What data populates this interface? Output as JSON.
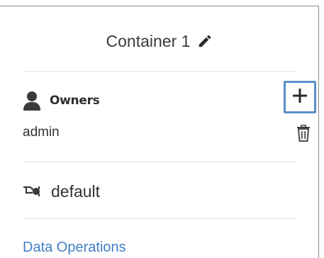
{
  "container": {
    "title": "Container 1"
  },
  "owners": {
    "label": "Owners",
    "items": [
      {
        "name": "admin"
      }
    ]
  },
  "connection": {
    "value": "default"
  },
  "links": {
    "data_operations": "Data Operations"
  },
  "colors": {
    "accent": "#3f7fc4",
    "focus_border": "#5a8fc9"
  },
  "icons": {
    "edit": "pencil-icon",
    "owner": "person-icon",
    "add": "plus-icon",
    "delete": "trash-icon",
    "connection": "cable-icon"
  }
}
